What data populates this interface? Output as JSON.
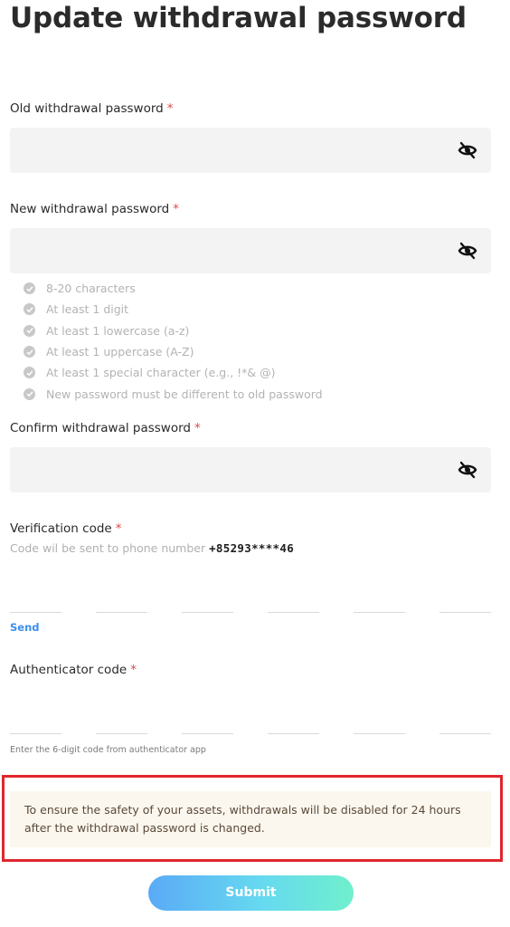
{
  "page": {
    "title": "Update withdrawal password"
  },
  "old_password": {
    "label": "Old withdrawal password",
    "required_mark": "*",
    "value": "",
    "icon": "eye-off-icon"
  },
  "new_password": {
    "label": "New withdrawal password",
    "required_mark": "*",
    "value": "",
    "icon": "eye-off-icon",
    "rules": [
      "8-20 characters",
      "At least 1 digit",
      "At least 1 lowercase (a-z)",
      "At least 1 uppercase (A-Z)",
      "At least 1 special character (e.g., !*& @)",
      "New password must be different to old password"
    ]
  },
  "confirm_password": {
    "label": "Confirm withdrawal password",
    "required_mark": "*",
    "value": "",
    "icon": "eye-off-icon"
  },
  "verification": {
    "label": "Verification code",
    "required_mark": "*",
    "hint": "Code wil be sent to phone number",
    "phone": "+85293****46",
    "digits": [
      "",
      "",
      "",
      "",
      "",
      ""
    ],
    "send_label": "Send"
  },
  "authenticator": {
    "label": "Authenticator code",
    "required_mark": "*",
    "digits": [
      "",
      "",
      "",
      "",
      "",
      ""
    ],
    "hint": "Enter the 6-digit code from authenticator app"
  },
  "notice": {
    "text": "To ensure the safety of your assets, withdrawals will be disabled for 24 hours after the withdrawal password is changed."
  },
  "actions": {
    "submit_label": "Submit"
  },
  "colors": {
    "required": "#e04848",
    "link": "#3a8ef0",
    "highlight_border": "#e0262e",
    "notice_bg": "#fcf7ee",
    "input_bg": "#f3f3f3"
  }
}
